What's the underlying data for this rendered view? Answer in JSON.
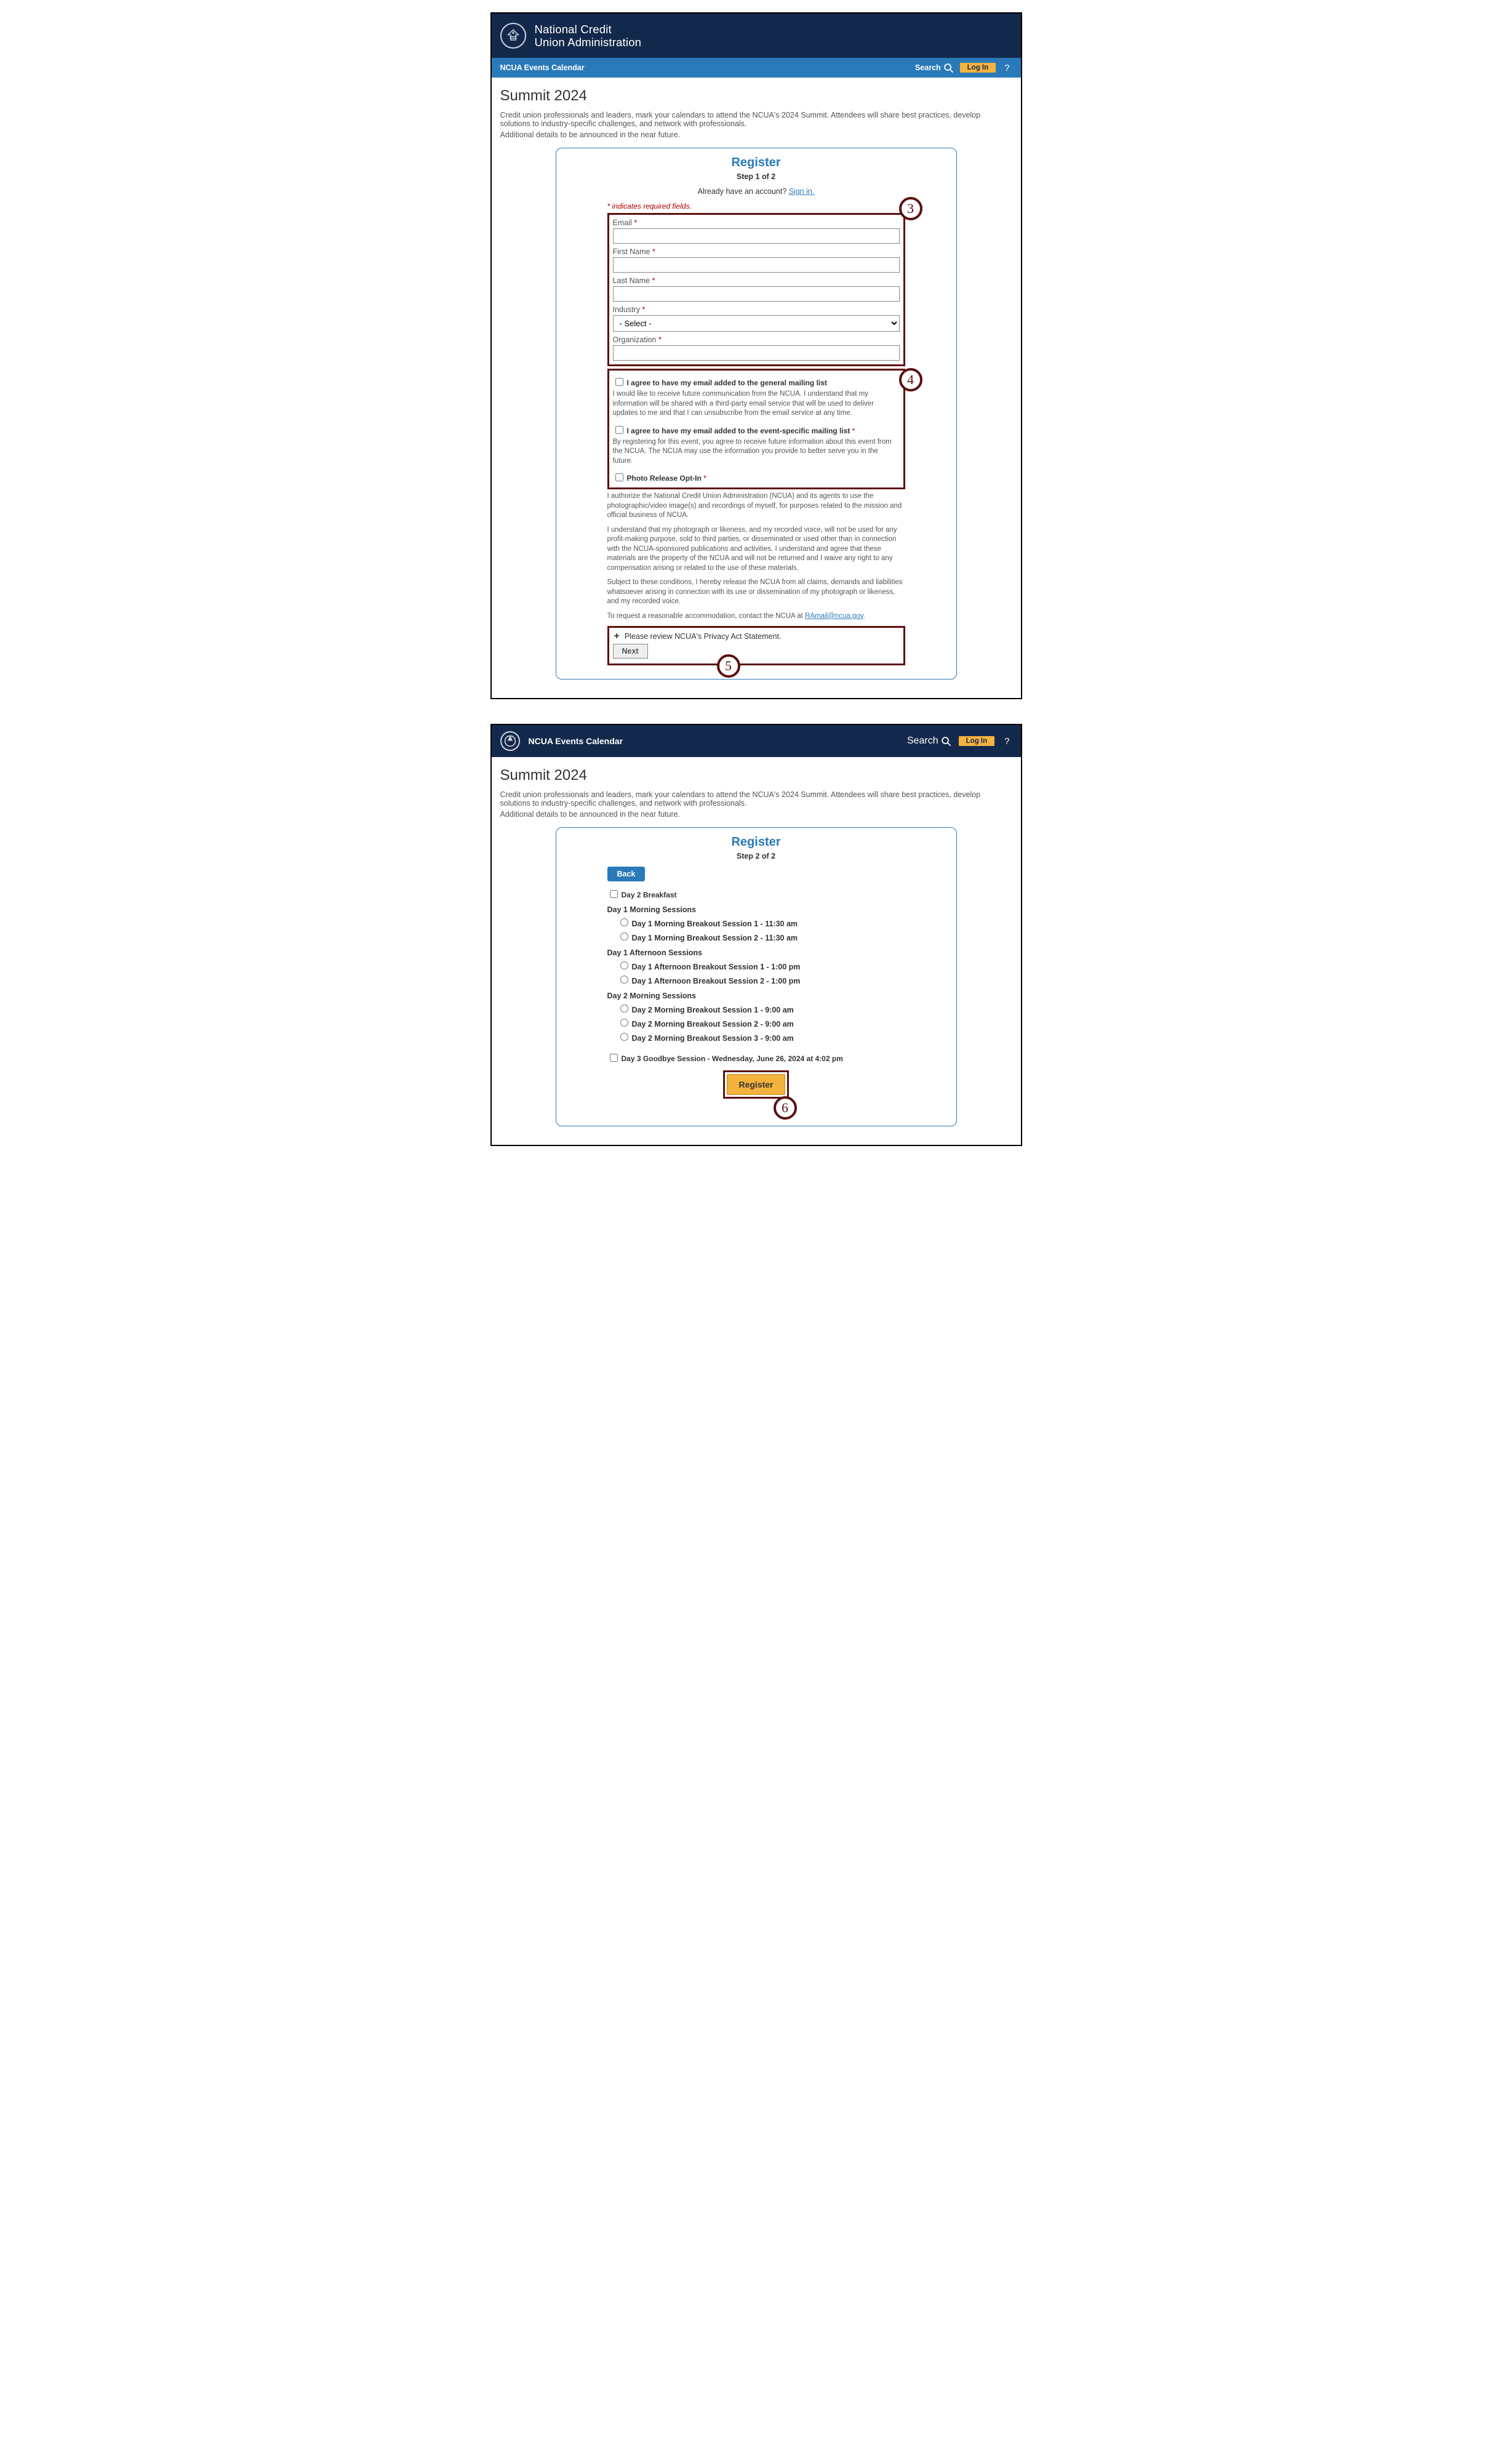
{
  "brand": {
    "org_line1": "National Credit",
    "org_line2": "Union Administration",
    "calendar_title": "NCUA Events Calendar"
  },
  "toolbar": {
    "search_label": "Search",
    "login_label": "Log In",
    "help_label": "?"
  },
  "page": {
    "title": "Summit 2024",
    "intro1": "Credit union professionals and leaders, mark your calendars to attend the NCUA's 2024 Summit. Attendees will share best practices, develop solutions to industry-specific challenges, and network with professionals.",
    "intro2": "Additional details to be announced in the near future."
  },
  "register": {
    "heading": "Register",
    "step1_label": "Step 1 of 2",
    "step2_label": "Step 2 of 2",
    "signin_prefix": "Already have an account? ",
    "signin_link": "Sign in.",
    "required_note": "* indicates required fields.",
    "fields": {
      "email": "Email",
      "first_name": "First Name",
      "last_name": "Last Name",
      "industry": "Industry",
      "industry_placeholder": "- Select -",
      "organization": "Organization"
    },
    "consents": {
      "general_list_label": "I agree to have my email added to the general mailing list",
      "general_list_text": "I would like to receive future communication from the NCUA. I understand that my information will be shared with a third-party email service that will be used to deliver updates to me and that I can unsubscribe from the email service at any time.",
      "event_list_label": "I agree to have my email added to the event-specific mailing list",
      "event_list_text": "By registering for this event, you agree to receive future information about this event from the NCUA. The NCUA may use the information you provide to better serve you in the future.",
      "photo_label": "Photo Release Opt-In"
    },
    "photo_p1": "I authorize the National Credit Union Administration (NCUA) and its agents to use the photographic/video image(s) and recordings of myself, for purposes related to the mission and official business of NCUA.",
    "photo_p2": "I understand that my photograph or likeness, and my recorded voice, will not be used for any profit-making purpose, sold to third parties, or disseminated or used other than in connection with the NCUA-sponsored publications and activities. I understand and agree that these materials are the property of the NCUA and will not be returned and I waive any right to any compensation arising or related to the use of these materials.",
    "photo_p3": "Subject to these conditions, I hereby release the NCUA from all claims, demands and liabilities whatsoever arising in connection with its use or dissemination of my photograph or likeness, and my recorded voice.",
    "accommodation_prefix": "To request a reasonable accommodation, contact the NCUA at ",
    "accommodation_link": "RAmail@ncua.gov",
    "privacy_expand": "Please review NCUA's Privacy Act Statement.",
    "next_label": "Next",
    "back_label": "Back",
    "register_label": "Register"
  },
  "sessions": {
    "day2_breakfast": "Day 2 Breakfast",
    "group1_title": "Day 1 Morning Sessions",
    "group1": [
      "Day 1 Morning Breakout Session 1 - 11:30 am",
      "Day 1 Morning Breakout Session 2 - 11:30 am"
    ],
    "group2_title": "Day 1 Afternoon Sessions",
    "group2": [
      "Day 1 Afternoon Breakout Session 1 - 1:00 pm",
      "Day 1 Afternoon Breakout Session 2 - 1:00 pm"
    ],
    "group3_title": "Day 2 Morning Sessions",
    "group3": [
      "Day 2 Morning Breakout Session 1 - 9:00 am",
      "Day 2 Morning Breakout Session 2 - 9:00 am",
      "Day 2 Morning Breakout Session 3 - 9:00 am"
    ],
    "goodbye": "Day 3 Goodbye Session - Wednesday, June 26, 2024 at 4:02 pm"
  },
  "annotations": {
    "b3": "3",
    "b4": "4",
    "b5": "5",
    "b6": "6"
  }
}
